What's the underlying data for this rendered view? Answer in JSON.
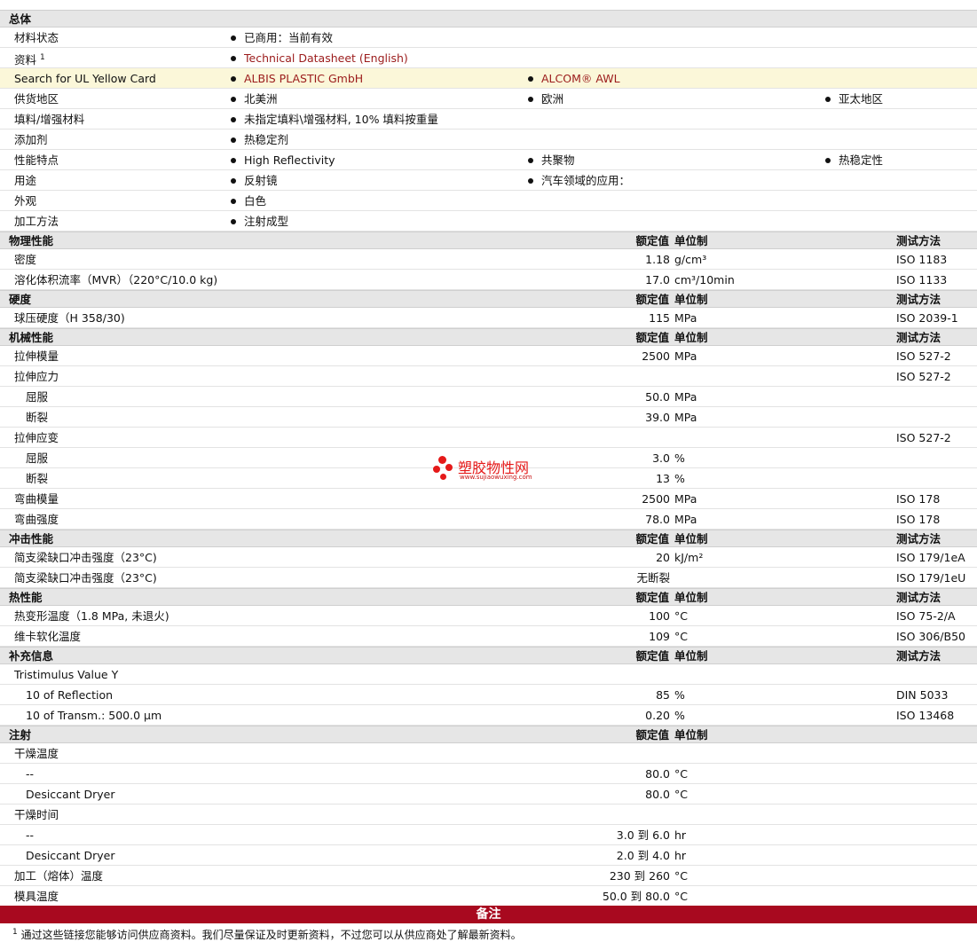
{
  "general": {
    "title": "总体",
    "material_status_label": "材料状态",
    "material_status_value": "已商用：当前有效",
    "docs_label": "资料",
    "docs_sup": "1",
    "docs_link": "Technical Datasheet (English)",
    "ul_label": "Search for UL Yellow Card",
    "ul_link1": "ALBIS PLASTIC GmbH",
    "ul_link2": "ALCOM® AWL",
    "supply_label": "供货地区",
    "supply_1": "北美洲",
    "supply_2": "欧洲",
    "supply_3": "亚太地区",
    "filler_label": "填料/增强材料",
    "filler_value": "未指定填料\\增强材料, 10% 填料按重量",
    "additive_label": "添加剂",
    "additive_value": "热稳定剂",
    "features_label": "性能特点",
    "features_1": "High Reflectivity",
    "features_2": "共聚物",
    "features_3": "热稳定性",
    "uses_label": "用途",
    "uses_1": "反射镜",
    "uses_2": "汽车领域的应用：",
    "appearance_label": "外观",
    "appearance_value": "白色",
    "processing_label": "加工方法",
    "processing_value": "注射成型"
  },
  "col_headers": {
    "rated": "额定值",
    "unit": "单位制",
    "test": "测试方法"
  },
  "physical": {
    "title": "物理性能",
    "density_label": "密度",
    "density_val": "1.18",
    "density_unit": "g/cm³",
    "density_test": "ISO 1183",
    "mvr_label": "溶化体积流率（MVR）（220°C/10.0 kg)",
    "mvr_val": "17.0",
    "mvr_unit": "cm³/10min",
    "mvr_test": "ISO 1133"
  },
  "hardness": {
    "title": "硬度",
    "ball_label": "球压硬度（H 358/30)",
    "ball_val": "115",
    "ball_unit": "MPa",
    "ball_test": "ISO 2039-1"
  },
  "mechanical": {
    "title": "机械性能",
    "tm_label": "拉伸模量",
    "tm_val": "2500",
    "tm_unit": "MPa",
    "tm_test": "ISO 527-2",
    "ts_label": "拉伸应力",
    "ts_test": "ISO 527-2",
    "ts_yield_label": "屈服",
    "ts_yield_val": "50.0",
    "ts_yield_unit": "MPa",
    "ts_break_label": "断裂",
    "ts_break_val": "39.0",
    "ts_break_unit": "MPa",
    "tst_label": "拉伸应变",
    "tst_test": "ISO 527-2",
    "tst_yield_label": "屈服",
    "tst_yield_val": "3.0",
    "tst_yield_unit": "%",
    "tst_break_label": "断裂",
    "tst_break_val": "13",
    "tst_break_unit": "%",
    "fm_label": "弯曲模量",
    "fm_val": "2500",
    "fm_unit": "MPa",
    "fm_test": "ISO 178",
    "fs_label": "弯曲强度",
    "fs_val": "78.0",
    "fs_unit": "MPa",
    "fs_test": "ISO 178"
  },
  "impact": {
    "title": "冲击性能",
    "notched_label": "简支梁缺口冲击强度（23°C)",
    "notched_val": "20",
    "notched_unit": "kJ/m²",
    "notched_test": "ISO 179/1eA",
    "unnotched_label": "简支梁缺口冲击强度（23°C)",
    "unnotched_val": "无断裂",
    "unnotched_test": "ISO 179/1eU"
  },
  "thermal": {
    "title": "热性能",
    "hdt_label": "热变形温度（1.8 MPa, 未退火)",
    "hdt_val": "100",
    "hdt_unit": "°C",
    "hdt_test": "ISO 75-2/A",
    "vicat_label": "维卡软化温度",
    "vicat_val": "109",
    "vicat_unit": "°C",
    "vicat_test": "ISO 306/B50"
  },
  "supplemental": {
    "title": "补充信息",
    "tri_label": "Tristimulus Value Y",
    "refl_label": "10 of Reflection",
    "refl_val": "85",
    "refl_unit": "%",
    "refl_test": "DIN 5033",
    "trans_label": "10 of Transm.: 500.0 µm",
    "trans_val": "0.20",
    "trans_unit": "%",
    "trans_test": "ISO 13468"
  },
  "injection": {
    "title": "注射",
    "dry_temp_label": "干燥温度",
    "dry_temp_dash_label": "--",
    "dry_temp_dash_val": "80.0",
    "dry_temp_dash_unit": "°C",
    "dry_temp_desic_label": "Desiccant Dryer",
    "dry_temp_desic_val": "80.0",
    "dry_temp_desic_unit": "°C",
    "dry_time_label": "干燥时间",
    "dry_time_dash_label": "--",
    "dry_time_dash_val": "3.0 到  6.0",
    "dry_time_dash_unit": "hr",
    "dry_time_desic_label": "Desiccant Dryer",
    "dry_time_desic_val": "2.0 到  4.0",
    "dry_time_desic_unit": "hr",
    "melt_label": "加工（熔体）温度",
    "melt_val": "230 到  260",
    "melt_unit": "°C",
    "mold_label": "模具温度",
    "mold_val": "50.0 到  80.0",
    "mold_unit": "°C"
  },
  "notes": {
    "title": "备注",
    "footnote_sup": "1",
    "footnote_text": "通过这些链接您能够访问供应商资料。我们尽量保证及时更新资料，不过您可以从供应商处了解最新资料。"
  },
  "watermark": {
    "title": "塑胶物性网",
    "url": "www.sujiaowuxing.com"
  }
}
